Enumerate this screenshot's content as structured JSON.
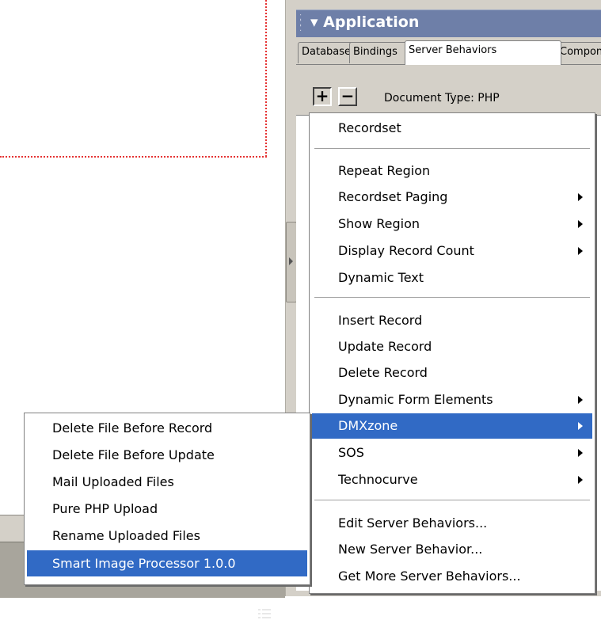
{
  "panel": {
    "title": "Application",
    "tabs": [
      "Databases",
      "Bindings",
      "Server Behaviors",
      "Components"
    ],
    "active_tab": "Server Behaviors",
    "toolbar": {
      "plus": "+",
      "minus": "−",
      "doctype": "Document Type: PHP"
    }
  },
  "menu": {
    "items": [
      {
        "label": "Recordset",
        "submenu": false
      },
      {
        "label": "Repeat Region",
        "submenu": false
      },
      {
        "label": "Recordset Paging",
        "submenu": true
      },
      {
        "label": "Show Region",
        "submenu": true
      },
      {
        "label": "Display Record Count",
        "submenu": true
      },
      {
        "label": "Dynamic Text",
        "submenu": false
      },
      {
        "label": "Insert Record",
        "submenu": false
      },
      {
        "label": "Update Record",
        "submenu": false
      },
      {
        "label": "Delete Record",
        "submenu": false
      },
      {
        "label": "Dynamic Form Elements",
        "submenu": true
      },
      {
        "label": "DMXzone",
        "submenu": true,
        "highlighted": true
      },
      {
        "label": "SOS",
        "submenu": true
      },
      {
        "label": "Technocurve",
        "submenu": true
      },
      {
        "label": "Edit Server Behaviors...",
        "submenu": false
      },
      {
        "label": "New Server Behavior...",
        "submenu": false
      },
      {
        "label": "Get More Server Behaviors...",
        "submenu": false
      }
    ]
  },
  "submenu": {
    "items": [
      {
        "label": "Delete File Before Record"
      },
      {
        "label": "Delete File Before Update"
      },
      {
        "label": "Mail Uploaded Files"
      },
      {
        "label": "Pure PHP Upload"
      },
      {
        "label": "Rename Uploaded Files"
      },
      {
        "label": "Smart Image Processor 1.0.0",
        "highlighted": true
      }
    ]
  },
  "colors": {
    "highlight": "#316ac5",
    "panel_header": "#6e7fa8",
    "guide": "#e53333"
  }
}
